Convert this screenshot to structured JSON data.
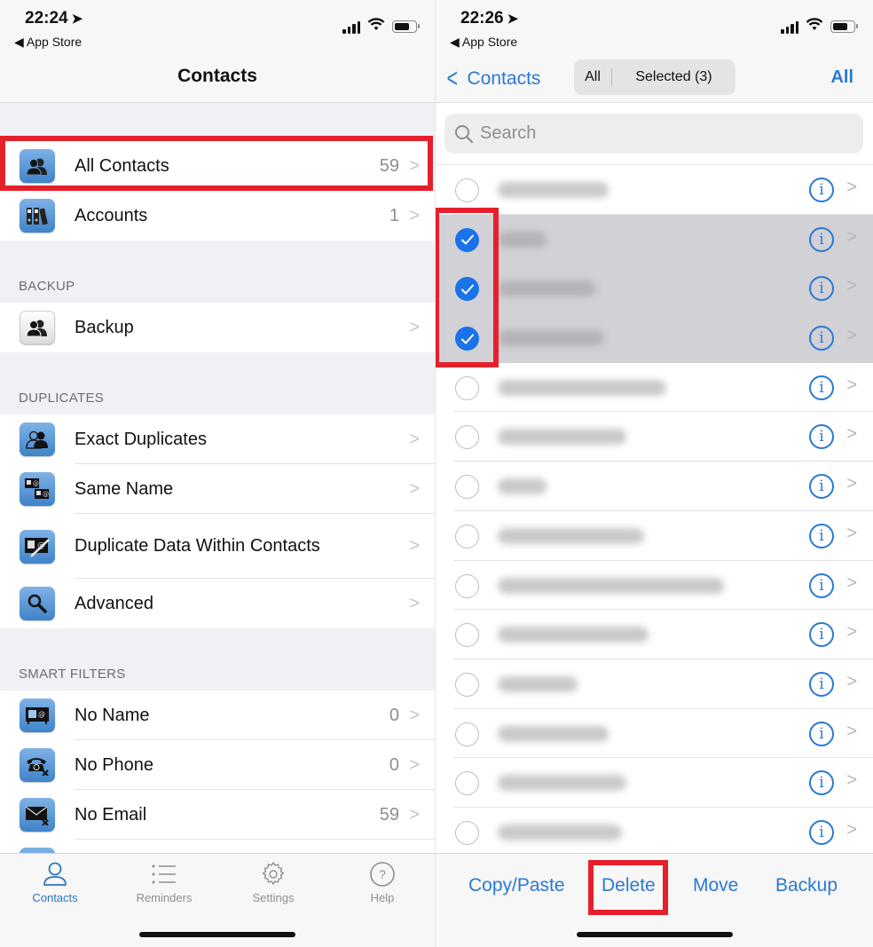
{
  "left_screen": {
    "status": {
      "time": "22:24",
      "back_app": "App Store"
    },
    "nav_title": "Contacts",
    "groups": [
      {
        "header": "",
        "rows": [
          {
            "label": "All Contacts",
            "count": "59",
            "icon": "two-people-icon",
            "highlighted": true
          },
          {
            "label": "Accounts",
            "count": "1",
            "icon": "binders-icon"
          }
        ]
      },
      {
        "header": "BACKUP",
        "rows": [
          {
            "label": "Backup",
            "count": "",
            "icon": "backup-people-icon"
          }
        ]
      },
      {
        "header": "DUPLICATES",
        "rows": [
          {
            "label": "Exact Duplicates",
            "count": "",
            "icon": "duplicate-people-icon"
          },
          {
            "label": "Same Name",
            "count": "",
            "icon": "same-name-cards-icon"
          },
          {
            "label": "Duplicate Data Within Contacts",
            "count": "",
            "icon": "duplicate-data-card-icon"
          },
          {
            "label": "Advanced",
            "count": "",
            "icon": "magnifier-icon"
          }
        ]
      },
      {
        "header": "SMART FILTERS",
        "rows": [
          {
            "label": "No Name",
            "count": "0",
            "icon": "no-name-card-icon"
          },
          {
            "label": "No Phone",
            "count": "0",
            "icon": "no-phone-icon"
          },
          {
            "label": "No Email",
            "count": "59",
            "icon": "no-email-icon"
          }
        ]
      }
    ],
    "tabbar": [
      {
        "label": "Contacts",
        "icon": "person-icon",
        "active": true
      },
      {
        "label": "Reminders",
        "icon": "list-icon",
        "active": false
      },
      {
        "label": "Settings",
        "icon": "gear-icon",
        "active": false
      },
      {
        "label": "Help",
        "icon": "question-circle-icon",
        "active": false
      }
    ]
  },
  "right_screen": {
    "status": {
      "time": "22:26",
      "back_app": "App Store"
    },
    "back_label": "Contacts",
    "segments": {
      "all": "All",
      "selected": "Selected (3)"
    },
    "select_all_label": "All",
    "search": {
      "placeholder": "Search",
      "value": ""
    },
    "contacts": [
      {
        "name": "[blurred]",
        "selected": false
      },
      {
        "name": "[blurred]",
        "selected": true
      },
      {
        "name": "[blurred]",
        "selected": true
      },
      {
        "name": "[blurred]",
        "selected": true
      },
      {
        "name": "[blurred]",
        "selected": false
      },
      {
        "name": "[blurred]",
        "selected": false
      },
      {
        "name": "[blurred]",
        "selected": false
      },
      {
        "name": "[blurred]",
        "selected": false
      },
      {
        "name": "[blurred]",
        "selected": false
      },
      {
        "name": "[blurred]",
        "selected": false
      },
      {
        "name": "[blurred]",
        "selected": false
      },
      {
        "name": "[blurred]",
        "selected": false
      },
      {
        "name": "[blurred]",
        "selected": false
      },
      {
        "name": "[blurred]",
        "selected": false
      }
    ],
    "toolbar": [
      {
        "label": "Copy/Paste"
      },
      {
        "label": "Delete",
        "highlighted": true
      },
      {
        "label": "Move"
      },
      {
        "label": "Backup"
      }
    ]
  },
  "colors": {
    "accent": "#2a79d4",
    "highlight": "#e5202b",
    "selected_row": "#d1d1d6",
    "check": "#1a73e8"
  }
}
